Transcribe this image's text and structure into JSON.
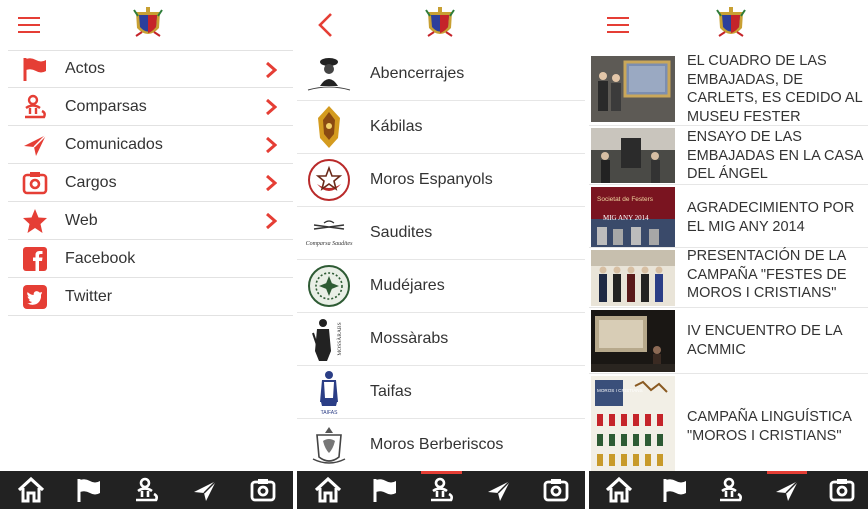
{
  "colors": {
    "accent": "#e53e35",
    "tabbar": "#222222",
    "text": "#333333"
  },
  "panel_menu": {
    "items": [
      {
        "label": "Actos",
        "icon": "flag-icon",
        "has_chevron": true
      },
      {
        "label": "Comparsas",
        "icon": "people-icon",
        "has_chevron": true
      },
      {
        "label": "Comunicados",
        "icon": "paper-plane-icon",
        "has_chevron": true
      },
      {
        "label": "Cargos",
        "icon": "camera-icon",
        "has_chevron": true
      },
      {
        "label": "Web",
        "icon": "star-icon",
        "has_chevron": true
      },
      {
        "label": "Facebook",
        "icon": "facebook-icon",
        "has_chevron": false
      },
      {
        "label": "Twitter",
        "icon": "twitter-icon",
        "has_chevron": false
      }
    ]
  },
  "panel_comparsas": {
    "items": [
      {
        "label": "Abencerrajes",
        "logo": "abencerrajes-logo"
      },
      {
        "label": "Kábilas",
        "logo": "kabilas-logo",
        "logo_text": ""
      },
      {
        "label": "Moros Espanyols",
        "logo": "moros-espanyols-logo",
        "logo_text": "MOROS ESPANYOLS"
      },
      {
        "label": "Saudites",
        "logo": "saudites-logo",
        "logo_text": "Comparsa Saudites"
      },
      {
        "label": "Mudéjares",
        "logo": "mudejares-logo"
      },
      {
        "label": "Mossàrabs",
        "logo": "mossarabs-logo",
        "logo_text": "MOSSÀRABS"
      },
      {
        "label": "Taifas",
        "logo": "taifas-logo",
        "logo_text": "TAIFAS"
      },
      {
        "label": "Moros Berberiscos",
        "logo": "moros-berberiscos-logo"
      }
    ]
  },
  "panel_news": {
    "items": [
      {
        "title": "EL CUADRO DE LAS EMBAJADAS, DE CARLETS, ES CEDIDO AL MUSEU FESTER"
      },
      {
        "title": "ENSAYO DE LAS EMBAJADAS EN LA CASA DEL ÁNGEL"
      },
      {
        "title": "AGRADECIMIENTO POR EL MIG ANY 2014",
        "thumb_text_1": "Societat de Festers",
        "thumb_text_2": "MIG ANY 2014"
      },
      {
        "title": "PRESENTACIÓN DE LA CAMPAÑA \"FESTES DE MOROS I CRISTIANS\""
      },
      {
        "title": "IV ENCUENTRO DE LA ACMMIC"
      },
      {
        "title": "CAMPAÑA LINGUÍSTICA \"MOROS I CRISTIANS\"",
        "thumb_text_1": "MOROS I CRISTIANS"
      }
    ]
  },
  "tabs": [
    {
      "icon": "home-icon"
    },
    {
      "icon": "flag-icon"
    },
    {
      "icon": "people-icon"
    },
    {
      "icon": "paper-plane-icon"
    },
    {
      "icon": "camera-icon"
    }
  ],
  "active_tabs": {
    "panel_menu": 0,
    "panel_comparsas": 2,
    "panel_news": 3
  }
}
